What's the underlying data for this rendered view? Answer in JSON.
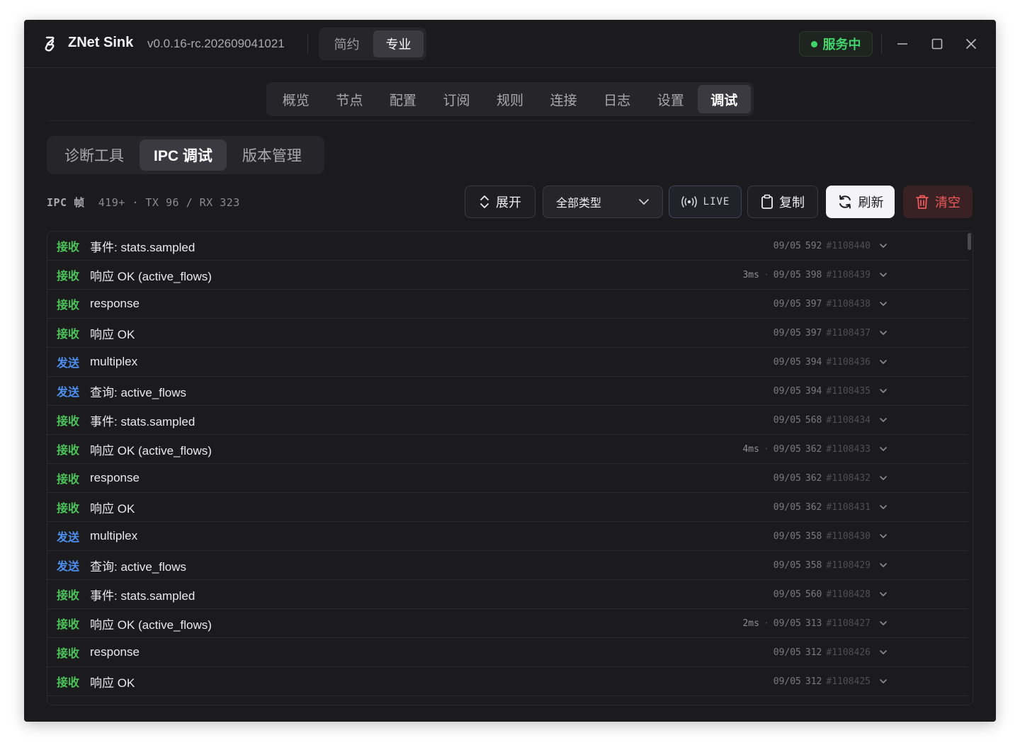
{
  "app": {
    "title": "ZNet Sink",
    "version": "v0.0.16-rc.202609041021",
    "mode_tabs": [
      {
        "label": "简约",
        "active": false
      },
      {
        "label": "专业",
        "active": true
      }
    ],
    "status": "服务中",
    "status_color": "#41d46b"
  },
  "main_nav": [
    {
      "label": "概览",
      "active": false
    },
    {
      "label": "节点",
      "active": false
    },
    {
      "label": "配置",
      "active": false
    },
    {
      "label": "订阅",
      "active": false
    },
    {
      "label": "规则",
      "active": false
    },
    {
      "label": "连接",
      "active": false
    },
    {
      "label": "日志",
      "active": false
    },
    {
      "label": "设置",
      "active": false
    },
    {
      "label": "调试",
      "active": true
    }
  ],
  "sub_tabs": [
    {
      "label": "诊断工具",
      "active": false
    },
    {
      "label": "IPC 调试",
      "active": true
    },
    {
      "label": "版本管理",
      "active": false
    }
  ],
  "stats": {
    "label": "IPC 帧",
    "frames": "419+",
    "tx": "TX 96",
    "rx": "RX 323"
  },
  "toolbar": {
    "expand": "展开",
    "type_filter": "全部类型",
    "live": "LIVE",
    "copy": "复制",
    "refresh": "刷新",
    "clear": "清空"
  },
  "colors": {
    "rx": "#4cc35a",
    "tx": "#4d8ff0",
    "danger": "#f05a5a"
  },
  "log_rows": [
    {
      "dir": "接收",
      "kind": "rx",
      "msg": "事件: stats.sampled",
      "dur": "",
      "date": "09/05",
      "num": "592",
      "id": "#1108440"
    },
    {
      "dir": "接收",
      "kind": "rx",
      "msg": "响应 OK (active_flows)",
      "dur": "3ms",
      "date": "09/05",
      "num": "398",
      "id": "#1108439"
    },
    {
      "dir": "接收",
      "kind": "rx",
      "msg": "response",
      "dur": "",
      "date": "09/05",
      "num": "397",
      "id": "#1108438"
    },
    {
      "dir": "接收",
      "kind": "rx",
      "msg": "响应 OK",
      "dur": "",
      "date": "09/05",
      "num": "397",
      "id": "#1108437"
    },
    {
      "dir": "发送",
      "kind": "tx",
      "msg": "multiplex",
      "dur": "",
      "date": "09/05",
      "num": "394",
      "id": "#1108436"
    },
    {
      "dir": "发送",
      "kind": "tx",
      "msg": "查询: active_flows",
      "dur": "",
      "date": "09/05",
      "num": "394",
      "id": "#1108435"
    },
    {
      "dir": "接收",
      "kind": "rx",
      "msg": "事件: stats.sampled",
      "dur": "",
      "date": "09/05",
      "num": "568",
      "id": "#1108434"
    },
    {
      "dir": "接收",
      "kind": "rx",
      "msg": "响应 OK (active_flows)",
      "dur": "4ms",
      "date": "09/05",
      "num": "362",
      "id": "#1108433"
    },
    {
      "dir": "接收",
      "kind": "rx",
      "msg": "response",
      "dur": "",
      "date": "09/05",
      "num": "362",
      "id": "#1108432"
    },
    {
      "dir": "接收",
      "kind": "rx",
      "msg": "响应 OK",
      "dur": "",
      "date": "09/05",
      "num": "362",
      "id": "#1108431"
    },
    {
      "dir": "发送",
      "kind": "tx",
      "msg": "multiplex",
      "dur": "",
      "date": "09/05",
      "num": "358",
      "id": "#1108430"
    },
    {
      "dir": "发送",
      "kind": "tx",
      "msg": "查询: active_flows",
      "dur": "",
      "date": "09/05",
      "num": "358",
      "id": "#1108429"
    },
    {
      "dir": "接收",
      "kind": "rx",
      "msg": "事件: stats.sampled",
      "dur": "",
      "date": "09/05",
      "num": "560",
      "id": "#1108428"
    },
    {
      "dir": "接收",
      "kind": "rx",
      "msg": "响应 OK (active_flows)",
      "dur": "2ms",
      "date": "09/05",
      "num": "313",
      "id": "#1108427"
    },
    {
      "dir": "接收",
      "kind": "rx",
      "msg": "response",
      "dur": "",
      "date": "09/05",
      "num": "312",
      "id": "#1108426"
    },
    {
      "dir": "接收",
      "kind": "rx",
      "msg": "响应 OK",
      "dur": "",
      "date": "09/05",
      "num": "312",
      "id": "#1108425"
    }
  ]
}
